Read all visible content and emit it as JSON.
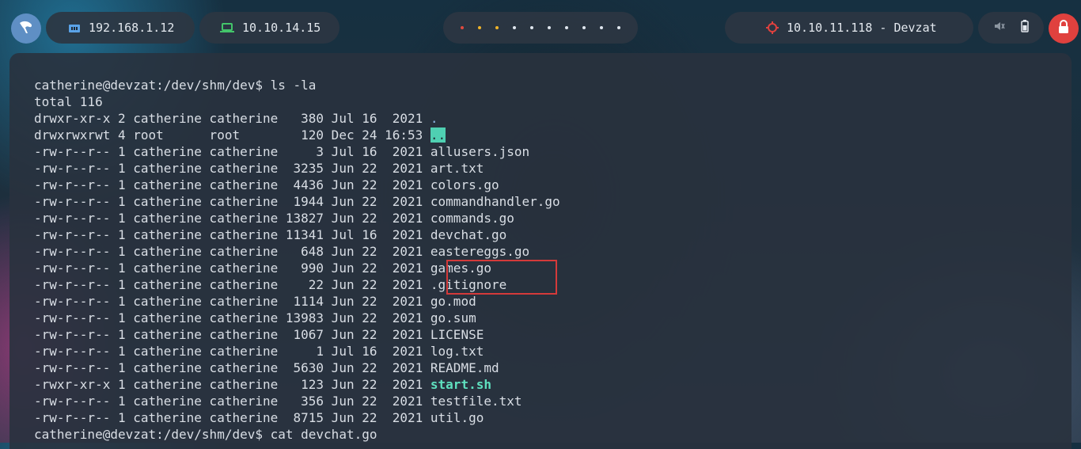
{
  "topbar": {
    "local_ip": "192.168.1.12",
    "vpn_ip": "10.10.14.15",
    "target_label": "10.10.11.118 - Devzat",
    "workspace_dots": [
      {
        "color": "#e04a3f"
      },
      {
        "color": "#f0b429"
      },
      {
        "color": "#f0b429"
      },
      {
        "color": "#dfe6ee"
      },
      {
        "color": "#dfe6ee"
      },
      {
        "color": "#dfe6ee"
      },
      {
        "color": "#dfe6ee"
      },
      {
        "color": "#dfe6ee"
      },
      {
        "color": "#dfe6ee"
      },
      {
        "color": "#dfe6ee"
      }
    ],
    "colors": {
      "network_icon": "#5aa3e8",
      "vpn_icon": "#43c46a",
      "target_icon": "#e0413e",
      "power_button": "#e0413e"
    }
  },
  "terminal": {
    "prompt_1": "catherine@devzat:/dev/shm/dev$ ls -la",
    "total": "total 116",
    "entries": [
      {
        "meta": "drwxr-xr-x 2 catherine catherine   380 Jul 16  2021 ",
        "name": ".",
        "kind": "dir"
      },
      {
        "meta": "drwxrwxrwt 4 root      root        120 Dec 24 16:53 ",
        "name": "..",
        "kind": "hl"
      },
      {
        "meta": "-rw-r--r-- 1 catherine catherine     3 Jul 16  2021 ",
        "name": "allusers.json",
        "kind": "file"
      },
      {
        "meta": "-rw-r--r-- 1 catherine catherine  3235 Jun 22  2021 ",
        "name": "art.txt",
        "kind": "file"
      },
      {
        "meta": "-rw-r--r-- 1 catherine catherine  4436 Jun 22  2021 ",
        "name": "colors.go",
        "kind": "file"
      },
      {
        "meta": "-rw-r--r-- 1 catherine catherine  1944 Jun 22  2021 ",
        "name": "commandhandler.go",
        "kind": "file"
      },
      {
        "meta": "-rw-r--r-- 1 catherine catherine 13827 Jun 22  2021 ",
        "name": "commands.go",
        "kind": "file"
      },
      {
        "meta": "-rw-r--r-- 1 catherine catherine 11341 Jul 16  2021 ",
        "name": "devchat.go",
        "kind": "file"
      },
      {
        "meta": "-rw-r--r-- 1 catherine catherine   648 Jun 22  2021 ",
        "name": "eastereggs.go",
        "kind": "file"
      },
      {
        "meta": "-rw-r--r-- 1 catherine catherine   990 Jun 22  2021 ",
        "name": "games.go",
        "kind": "file"
      },
      {
        "meta": "-rw-r--r-- 1 catherine catherine    22 Jun 22  2021 ",
        "name": ".gitignore",
        "kind": "file"
      },
      {
        "meta": "-rw-r--r-- 1 catherine catherine  1114 Jun 22  2021 ",
        "name": "go.mod",
        "kind": "file"
      },
      {
        "meta": "-rw-r--r-- 1 catherine catherine 13983 Jun 22  2021 ",
        "name": "go.sum",
        "kind": "file"
      },
      {
        "meta": "-rw-r--r-- 1 catherine catherine  1067 Jun 22  2021 ",
        "name": "LICENSE",
        "kind": "file"
      },
      {
        "meta": "-rw-r--r-- 1 catherine catherine     1 Jul 16  2021 ",
        "name": "log.txt",
        "kind": "file"
      },
      {
        "meta": "-rw-r--r-- 1 catherine catherine  5630 Jun 22  2021 ",
        "name": "README.md",
        "kind": "file"
      },
      {
        "meta": "-rwxr-xr-x 1 catherine catherine   123 Jun 22  2021 ",
        "name": "start.sh",
        "kind": "exec"
      },
      {
        "meta": "-rw-r--r-- 1 catherine catherine   356 Jun 22  2021 ",
        "name": "testfile.txt",
        "kind": "file"
      },
      {
        "meta": "-rw-r--r-- 1 catherine catherine  8715 Jun 22  2021 ",
        "name": "util.go",
        "kind": "file"
      }
    ],
    "prompt_2": "catherine@devzat:/dev/shm/dev$ cat devchat.go",
    "highlight_color": "#d43a3a"
  }
}
